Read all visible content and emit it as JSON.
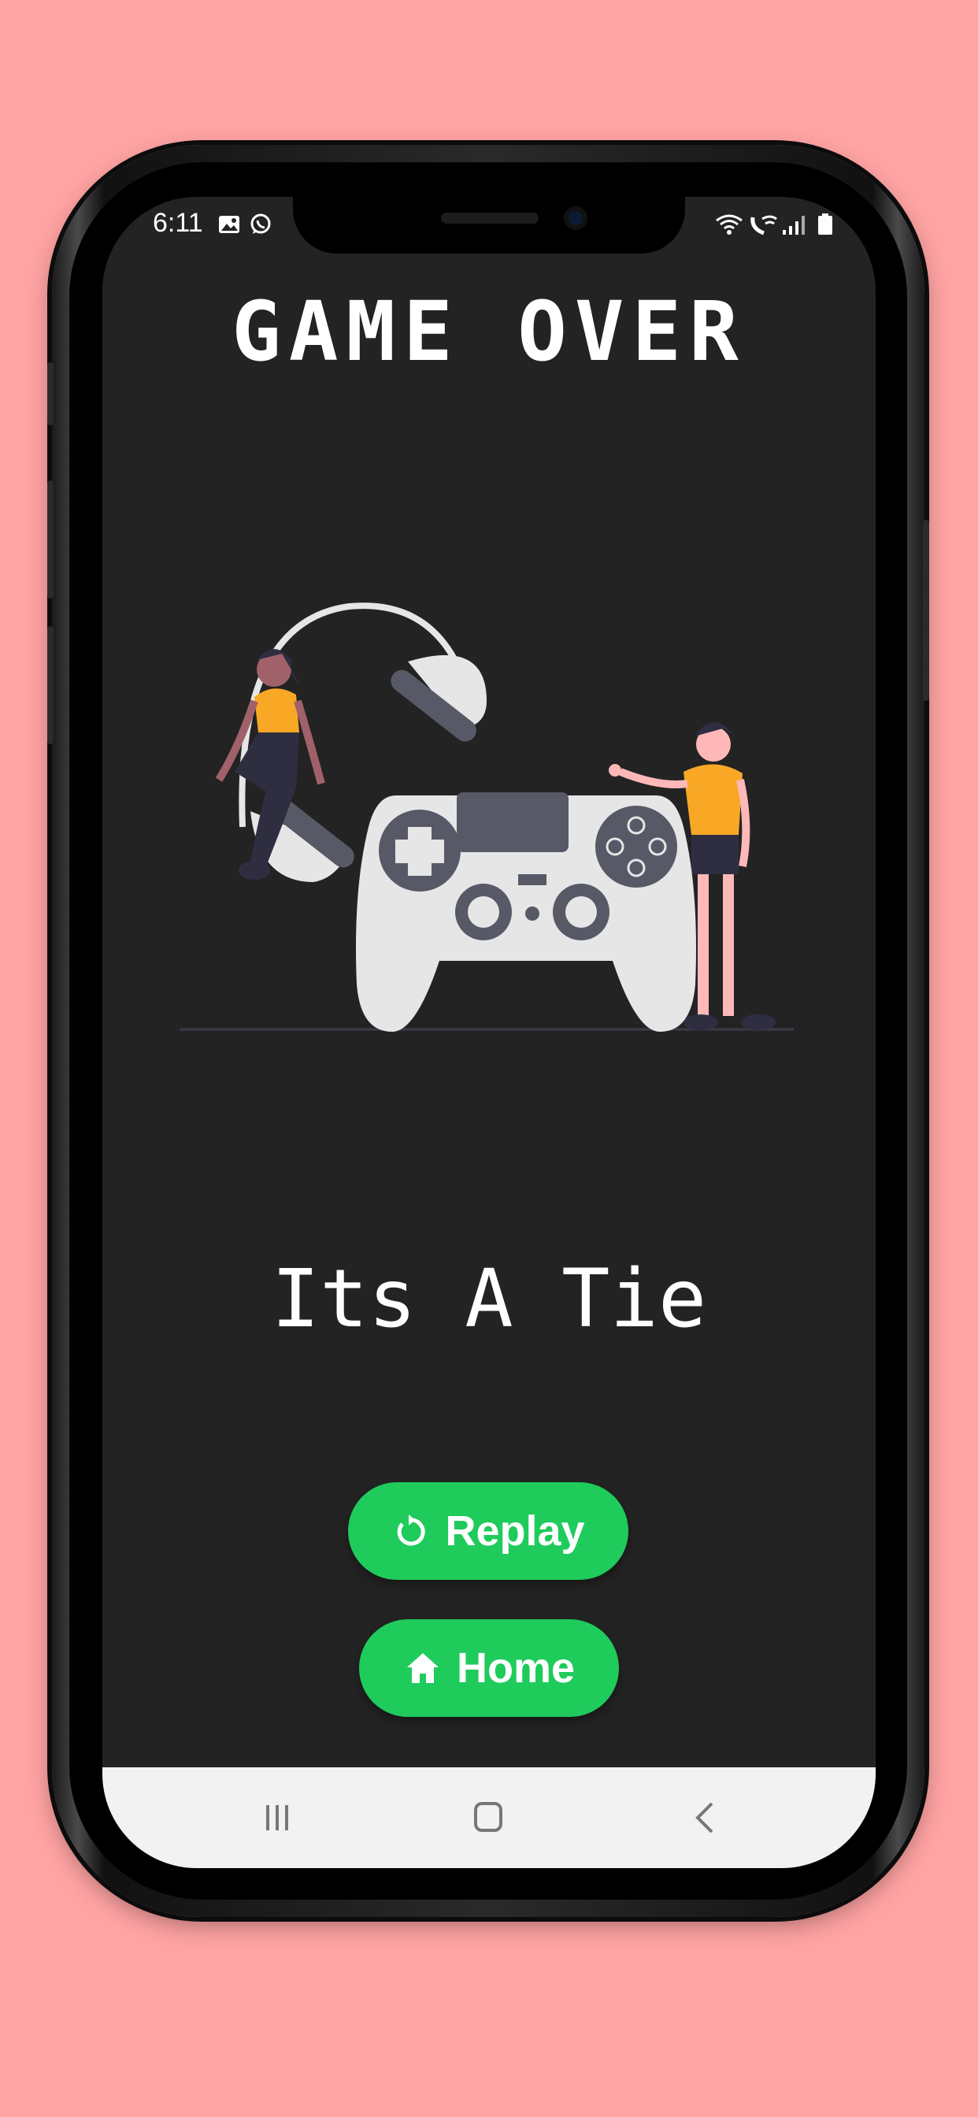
{
  "status_bar": {
    "time": "6:11",
    "left_icons": [
      "image-icon",
      "whatsapp-icon"
    ],
    "right_icons": [
      "wifi-icon",
      "wifi-calling-icon",
      "signal-icon",
      "battery-icon"
    ]
  },
  "game": {
    "title": "GAME OVER",
    "result": "Its A Tie"
  },
  "buttons": {
    "replay_label": "Replay",
    "replay_icon": "replay-icon",
    "home_label": "Home",
    "home_icon": "home-icon"
  },
  "nav_bar": {
    "icons": [
      "recent-apps-icon",
      "home-nav-icon",
      "back-icon"
    ]
  },
  "colors": {
    "background": "#ffa3a3",
    "screen": "#232323",
    "accent_green": "#1fcb5b",
    "figure_yellow": "#f9a826"
  }
}
